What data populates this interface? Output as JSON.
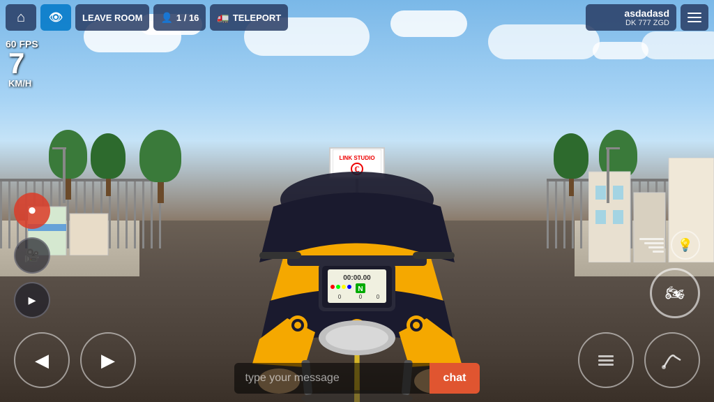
{
  "hud": {
    "home_label": "🏠",
    "eye_label": "👁",
    "leave_room_label": "LEAVE ROOM",
    "players_label": "1 / 16",
    "teleport_label": "TELEPORT",
    "fps": "60 FPS",
    "speed_value": "7",
    "speed_unit": "KM/H"
  },
  "player": {
    "name": "asdadasd",
    "plate": "DK 777 ZGD"
  },
  "chat": {
    "placeholder": "type your message",
    "button_label": "chat"
  },
  "icons": {
    "home": "⌂",
    "eye": "◉",
    "person": "👤",
    "truck": "🚛",
    "menu": "≡",
    "record": "⏺",
    "camera": "📷",
    "horn": "📯",
    "left_arrow": "◀",
    "right_arrow": "▶",
    "headlight": "💡",
    "moto_badge": "🏍"
  }
}
